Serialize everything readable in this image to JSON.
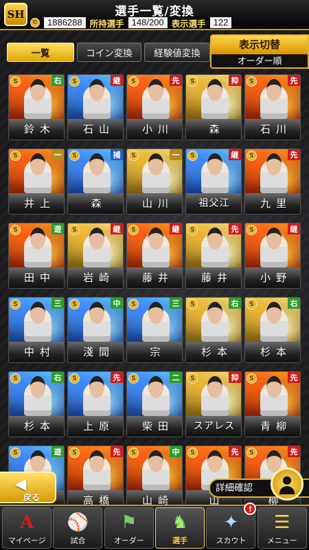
{
  "header": {
    "logo": "SH",
    "title": "選手一覧/変換",
    "coins": "1886288",
    "owned_label": "所持選手",
    "owned_value": "148/200",
    "shown_label": "表示選手",
    "shown_value": "122"
  },
  "tabs": [
    {
      "label": "一覧",
      "active": true
    },
    {
      "label": "コイン変換",
      "active": false
    },
    {
      "label": "経験値変換",
      "active": false
    }
  ],
  "sort": {
    "title": "表示切替",
    "value": "オーダー順"
  },
  "cards": [
    {
      "name": "鈴木",
      "pos": "右",
      "pos_color": "right",
      "art": "red"
    },
    {
      "name": "石山",
      "pos": "継",
      "pos_color": "red",
      "art": "blue"
    },
    {
      "name": "小川",
      "pos": "先",
      "pos_color": "red",
      "art": "red"
    },
    {
      "name": "森",
      "pos": "抑",
      "pos_color": "red",
      "art": "gold"
    },
    {
      "name": "石川",
      "pos": "先",
      "pos_color": "red",
      "art": "red"
    },
    {
      "name": "井上",
      "pos": "一",
      "pos_color": "gold",
      "art": "red"
    },
    {
      "name": "森",
      "pos": "捕",
      "pos_color": "blue",
      "art": "blue"
    },
    {
      "name": "山川",
      "pos": "一",
      "pos_color": "gold",
      "art": "gold"
    },
    {
      "name": "祖父江",
      "pos": "継",
      "pos_color": "red",
      "art": "blue"
    },
    {
      "name": "九里",
      "pos": "先",
      "pos_color": "red",
      "art": "red"
    },
    {
      "name": "田中",
      "pos": "遊",
      "pos_color": "right",
      "art": "red"
    },
    {
      "name": "岩崎",
      "pos": "継",
      "pos_color": "red",
      "art": "gold"
    },
    {
      "name": "藤井",
      "pos": "継",
      "pos_color": "red",
      "art": "red"
    },
    {
      "name": "藤井",
      "pos": "先",
      "pos_color": "red",
      "art": "gold"
    },
    {
      "name": "小野",
      "pos": "継",
      "pos_color": "red",
      "art": "red"
    },
    {
      "name": "中村",
      "pos": "三",
      "pos_color": "right",
      "art": "blue"
    },
    {
      "name": "淺間",
      "pos": "中",
      "pos_color": "right",
      "art": "blue"
    },
    {
      "name": "宗",
      "pos": "三",
      "pos_color": "right",
      "art": "blue"
    },
    {
      "name": "杉本",
      "pos": "右",
      "pos_color": "right",
      "art": "gold"
    },
    {
      "name": "杉本",
      "pos": "右",
      "pos_color": "right",
      "art": "gold"
    },
    {
      "name": "杉本",
      "pos": "右",
      "pos_color": "right",
      "art": "blue"
    },
    {
      "name": "上原",
      "pos": "先",
      "pos_color": "red",
      "art": "blue"
    },
    {
      "name": "柴田",
      "pos": "二",
      "pos_color": "right",
      "art": "blue"
    },
    {
      "name": "スアレス",
      "pos": "抑",
      "pos_color": "red",
      "art": "gold"
    },
    {
      "name": "青柳",
      "pos": "先",
      "pos_color": "red",
      "art": "red"
    },
    {
      "name": "",
      "pos": "遊",
      "pos_color": "right",
      "art": "blue"
    },
    {
      "name": "高橋",
      "pos": "先",
      "pos_color": "red",
      "art": "red"
    },
    {
      "name": "山崎",
      "pos": "中",
      "pos_color": "right",
      "art": "red"
    },
    {
      "name": "山",
      "pos": "先",
      "pos_color": "red",
      "art": "red"
    },
    {
      "name": "柳",
      "pos": "先",
      "pos_color": "red",
      "art": "red"
    }
  ],
  "back_button": {
    "label": "戻る"
  },
  "detail_button": {
    "label": "詳細確認"
  },
  "nav": [
    {
      "label": "マイページ",
      "icon": "A",
      "badge": ""
    },
    {
      "label": "試合",
      "icon": "⚾",
      "badge": ""
    },
    {
      "label": "オーダー",
      "icon": "⚑",
      "badge": ""
    },
    {
      "label": "選手",
      "icon": "♞",
      "badge": "",
      "active": true
    },
    {
      "label": "スカウト",
      "icon": "✦",
      "badge": "!"
    },
    {
      "label": "メニュー",
      "icon": "☰",
      "badge": ""
    }
  ]
}
